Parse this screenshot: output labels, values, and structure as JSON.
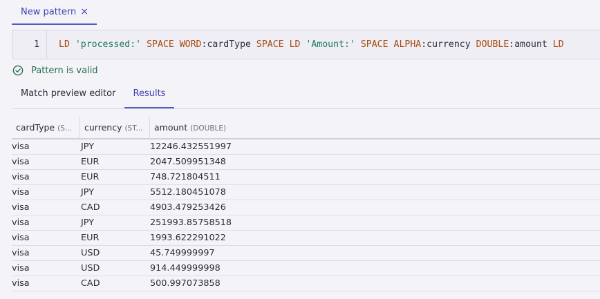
{
  "tab": {
    "label": "New pattern",
    "close_glyph": "×"
  },
  "editor": {
    "line_number": "1",
    "tokens": [
      {
        "text": "LD",
        "kind": "kw"
      },
      {
        "text": " ",
        "kind": "plain"
      },
      {
        "text": "'processed:'",
        "kind": "str"
      },
      {
        "text": " ",
        "kind": "plain"
      },
      {
        "text": "SPACE",
        "kind": "kw"
      },
      {
        "text": " ",
        "kind": "plain"
      },
      {
        "text": "WORD",
        "kind": "kw"
      },
      {
        "text": ":cardType",
        "kind": "plain"
      },
      {
        "text": " ",
        "kind": "plain"
      },
      {
        "text": "SPACE",
        "kind": "kw"
      },
      {
        "text": " ",
        "kind": "plain"
      },
      {
        "text": "LD",
        "kind": "kw"
      },
      {
        "text": " ",
        "kind": "plain"
      },
      {
        "text": "'Amount:'",
        "kind": "str"
      },
      {
        "text": " ",
        "kind": "plain"
      },
      {
        "text": "SPACE",
        "kind": "kw"
      },
      {
        "text": " ",
        "kind": "plain"
      },
      {
        "text": "ALPHA",
        "kind": "kw"
      },
      {
        "text": ":currency",
        "kind": "plain"
      },
      {
        "text": " ",
        "kind": "plain"
      },
      {
        "text": "DOUBLE",
        "kind": "kw"
      },
      {
        "text": ":amount",
        "kind": "plain"
      },
      {
        "text": " ",
        "kind": "plain"
      },
      {
        "text": "LD",
        "kind": "kw"
      }
    ]
  },
  "validation": {
    "message": "Pattern is valid",
    "icon": "check-circle-icon",
    "color": "#2a6b52"
  },
  "subtabs": {
    "preview_label": "Match preview editor",
    "results_label": "Results",
    "active": "Results"
  },
  "table": {
    "columns": [
      {
        "name": "cardType",
        "type": "(S..."
      },
      {
        "name": "currency",
        "type": "(ST..."
      },
      {
        "name": "amount",
        "type": "(DOUBLE)"
      }
    ],
    "rows": [
      [
        "visa",
        "JPY",
        "12246.432551997"
      ],
      [
        "visa",
        "EUR",
        "2047.509951348"
      ],
      [
        "visa",
        "EUR",
        "748.721804511"
      ],
      [
        "visa",
        "JPY",
        "5512.180451078"
      ],
      [
        "visa",
        "CAD",
        "4903.479253426"
      ],
      [
        "visa",
        "JPY",
        "251993.85758518"
      ],
      [
        "visa",
        "EUR",
        "1993.622291022"
      ],
      [
        "visa",
        "USD",
        "45.749999997"
      ],
      [
        "visa",
        "USD",
        "914.449999998"
      ],
      [
        "visa",
        "CAD",
        "500.997073858"
      ]
    ]
  },
  "colors": {
    "accent": "#5558c5",
    "keyword": "#a8490e",
    "string": "#1f7a5c",
    "background": "#f4f4f8"
  }
}
